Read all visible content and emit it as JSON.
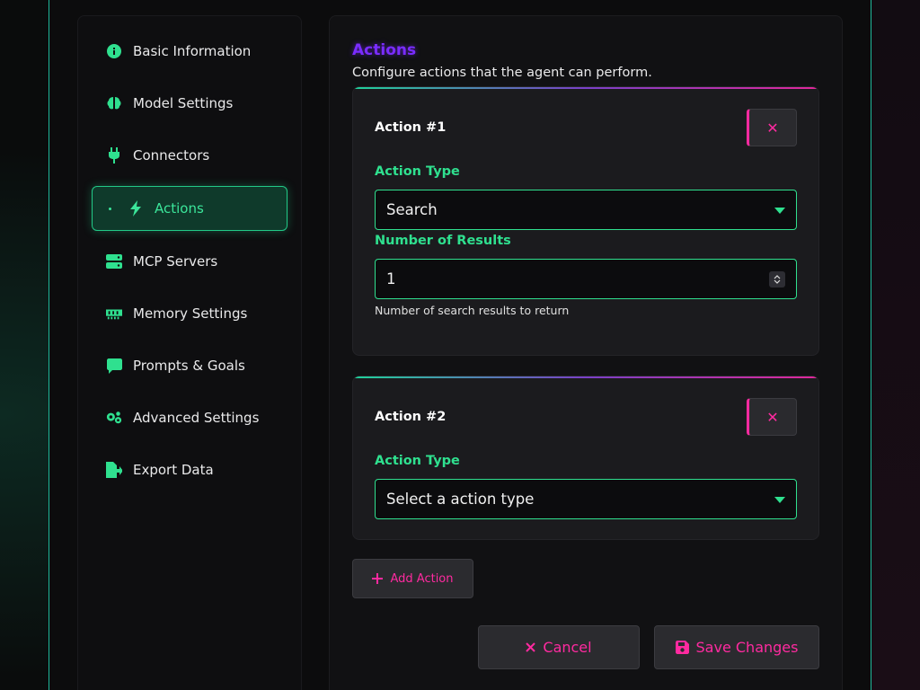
{
  "sidebar": {
    "items": [
      {
        "label": "Basic Information",
        "icon": "info-circle-icon"
      },
      {
        "label": "Model Settings",
        "icon": "brain-icon"
      },
      {
        "label": "Connectors",
        "icon": "plug-icon"
      },
      {
        "label": "Actions",
        "icon": "bolt-icon",
        "active": true
      },
      {
        "label": "MCP Servers",
        "icon": "server-icon"
      },
      {
        "label": "Memory Settings",
        "icon": "memory-icon"
      },
      {
        "label": "Prompts & Goals",
        "icon": "comment-icon"
      },
      {
        "label": "Advanced Settings",
        "icon": "gears-icon"
      },
      {
        "label": "Export Data",
        "icon": "file-export-icon"
      }
    ]
  },
  "main": {
    "title": "Actions",
    "description": "Configure actions that the agent can perform.",
    "actions": [
      {
        "title": "Action #1",
        "type_label": "Action Type",
        "type_value": "Search",
        "results_label": "Number of Results",
        "results_value": "1",
        "results_hint": "Number of search results to return"
      },
      {
        "title": "Action #2",
        "type_label": "Action Type",
        "type_value": "Select a action type"
      }
    ],
    "remove_symbol": "✕",
    "add_label": "Add Action",
    "cancel_label": "Cancel",
    "save_label": "Save Changes"
  },
  "colors": {
    "accent_green": "#2fe08f",
    "accent_pink": "#ff2aa0",
    "accent_purple": "#7a2cff"
  }
}
